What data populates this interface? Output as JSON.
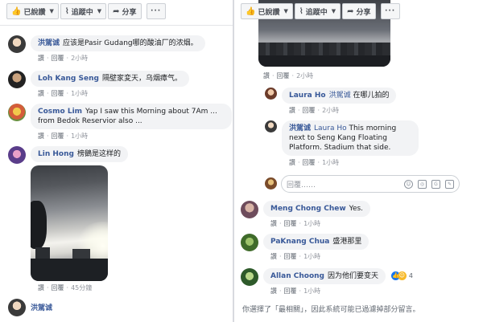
{
  "toolbar": {
    "liked_label": "已說讚",
    "following_label": "追蹤中",
    "share_label": "分享",
    "more_label": "···"
  },
  "left": {
    "comments": [
      {
        "author": "洪駕诚",
        "text": "应该是Pasir Gudang哪的酸油厂的浓烟。",
        "time": "2小時"
      },
      {
        "author": "Loh Kang Seng",
        "text": "隔壁家変天，乌烟瘴气。",
        "time": "1小時"
      },
      {
        "author": "Cosmo Lim",
        "text": "Yap I saw this Morning about 7Am ... from Bedok Reservior also ...",
        "time": "1小時"
      },
      {
        "author": "Lin Hong",
        "text": "榜鵝是这样的",
        "time": "45分鐘"
      },
      {
        "author": "洪駕诚",
        "text": "",
        "time": ""
      }
    ]
  },
  "right": {
    "photo_time": "2小時",
    "comments": [
      {
        "author": "Laura Ho",
        "mention": "洪駕诚",
        "text": "在哪儿拍的",
        "time": "2小時"
      },
      {
        "author": "洪駕诚",
        "mention": "Laura Ho",
        "text": "This morning next to Seng Kang Floating Platform. Stadium that side.",
        "time": "1小時"
      },
      {
        "author": "Meng Chong Chew",
        "text": "Yes.",
        "time": "1小時"
      },
      {
        "author": "PaKnang Chua",
        "text": "盛港那里",
        "time": "1小時"
      },
      {
        "author": "Allan Choong",
        "text": "因为他们要变天",
        "time": "1小時",
        "reactions": "4"
      }
    ],
    "reply_placeholder": "回覆……",
    "footer": "你選擇了「最相關」，因此系統可能已過濾掉部分留言。"
  },
  "common": {
    "like": "讚",
    "reply": "回覆"
  },
  "colors": {
    "link": "#385898",
    "bubble": "#f2f3f5",
    "muted": "#90949c"
  },
  "icons": [
    "thumbs-up-icon",
    "rss-icon",
    "share-arrow-icon",
    "more-icon",
    "emoji-icon",
    "camera-icon",
    "gif-icon",
    "sticker-icon"
  ]
}
